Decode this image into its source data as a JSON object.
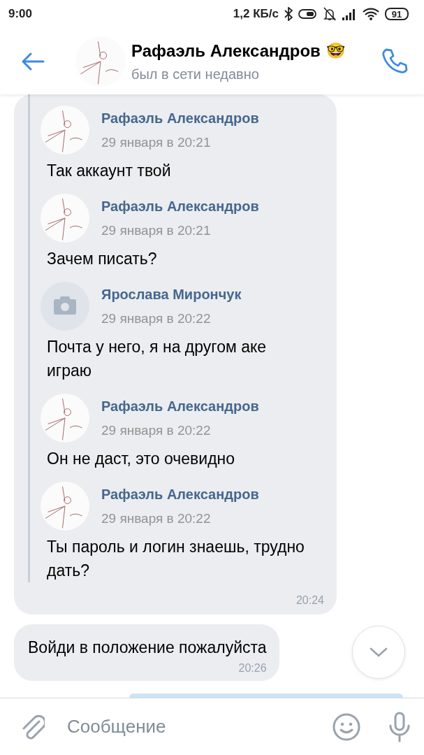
{
  "status_bar": {
    "time": "9:00",
    "network_speed": "1,2 КБ/с",
    "battery": "91"
  },
  "header": {
    "name": "Рафаэль Александров",
    "emoji": "🤓",
    "status": "был в сети недавно"
  },
  "messages": [
    {
      "kind": "forwarded",
      "time": "20:24",
      "forwarded": [
        {
          "kind": "picture",
          "author": "Рафаэль Александров",
          "date": "29 января в 20:21",
          "text": "Так аккаунт твой"
        },
        {
          "kind": "picture",
          "author": "Рафаэль Александров",
          "date": "29 января в 20:21",
          "text": "Зачем писать?"
        },
        {
          "kind": "placeholder",
          "author": "Ярослава Мирончук",
          "date": "29 января в 20:22",
          "text": "Почта у него, я на другом аке играю"
        },
        {
          "kind": "picture",
          "author": "Рафаэль Александров",
          "date": "29 января в 20:22",
          "text": "Он не даст, это очевидно"
        },
        {
          "kind": "picture",
          "author": "Рафаэль Александров",
          "date": "29 января в 20:22",
          "text": "Ты пароль и логин знаешь, трудно дать?"
        }
      ]
    },
    {
      "kind": "text",
      "text": "Войди в положение пожалуйста",
      "time": "20:26"
    },
    {
      "kind": "outgoing_cut"
    }
  ],
  "composer": {
    "placeholder": "Сообщение"
  }
}
